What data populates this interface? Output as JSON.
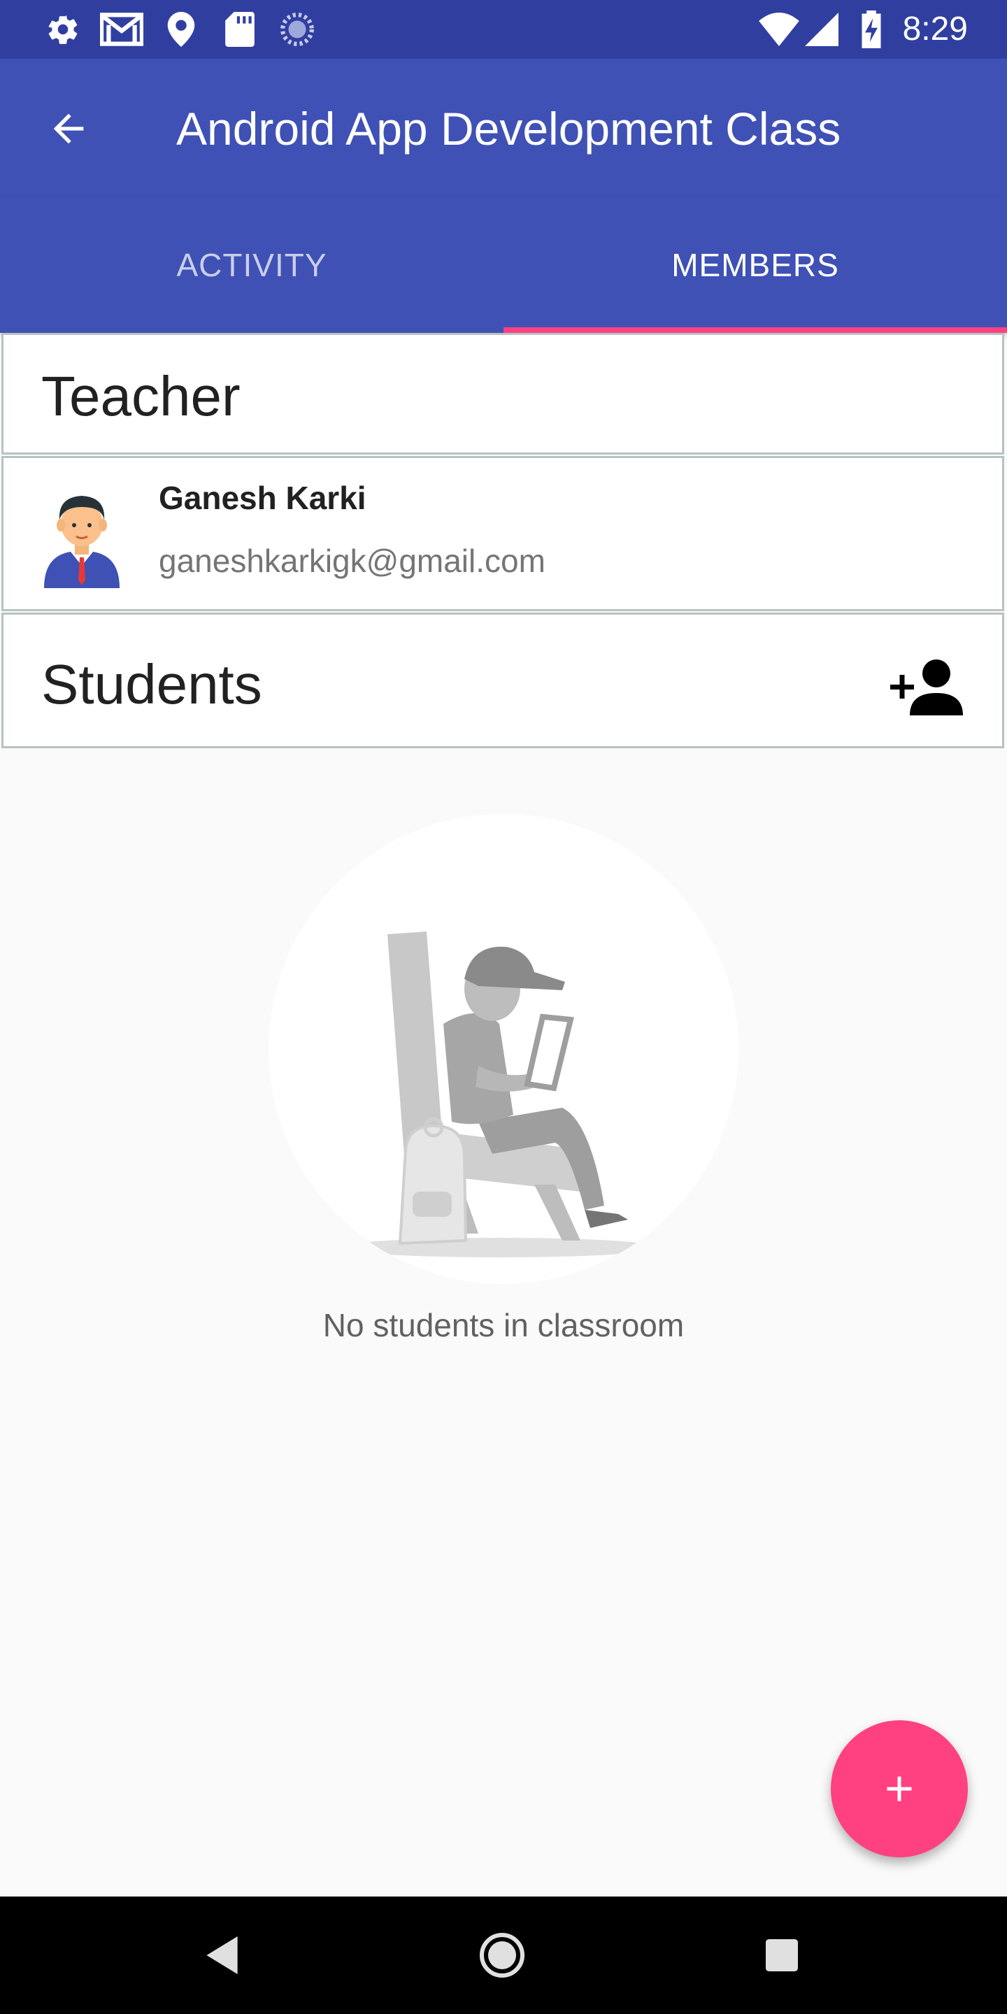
{
  "status_bar": {
    "time": "8:29",
    "left_icons": [
      "settings-icon",
      "gmail-icon",
      "location-icon",
      "sd-card-icon",
      "sync-icon"
    ],
    "right_icons": [
      "wifi-icon",
      "signal-icon",
      "battery-charging-icon"
    ]
  },
  "toolbar": {
    "title": "Android App Development Class",
    "back_icon": "arrow-back-icon"
  },
  "tabs": [
    {
      "label": "ACTIVITY",
      "selected": false
    },
    {
      "label": "MEMBERS",
      "selected": true
    }
  ],
  "colors": {
    "primary": "#3f51b5",
    "primary_dark": "#303f9f",
    "accent": "#ff4081"
  },
  "teacher_section": {
    "heading": "Teacher",
    "members": [
      {
        "name": "Ganesh Karki",
        "email": "ganeshkarkigk@gmail.com",
        "avatar": "teacher-avatar-icon"
      }
    ]
  },
  "students_section": {
    "heading": "Students",
    "add_icon": "add-person-icon",
    "empty_message": "No students in classroom"
  },
  "fab": {
    "icon": "plus-icon"
  },
  "nav_bar": {
    "icons": [
      "back-triangle-icon",
      "home-circle-icon",
      "recents-square-icon"
    ]
  }
}
